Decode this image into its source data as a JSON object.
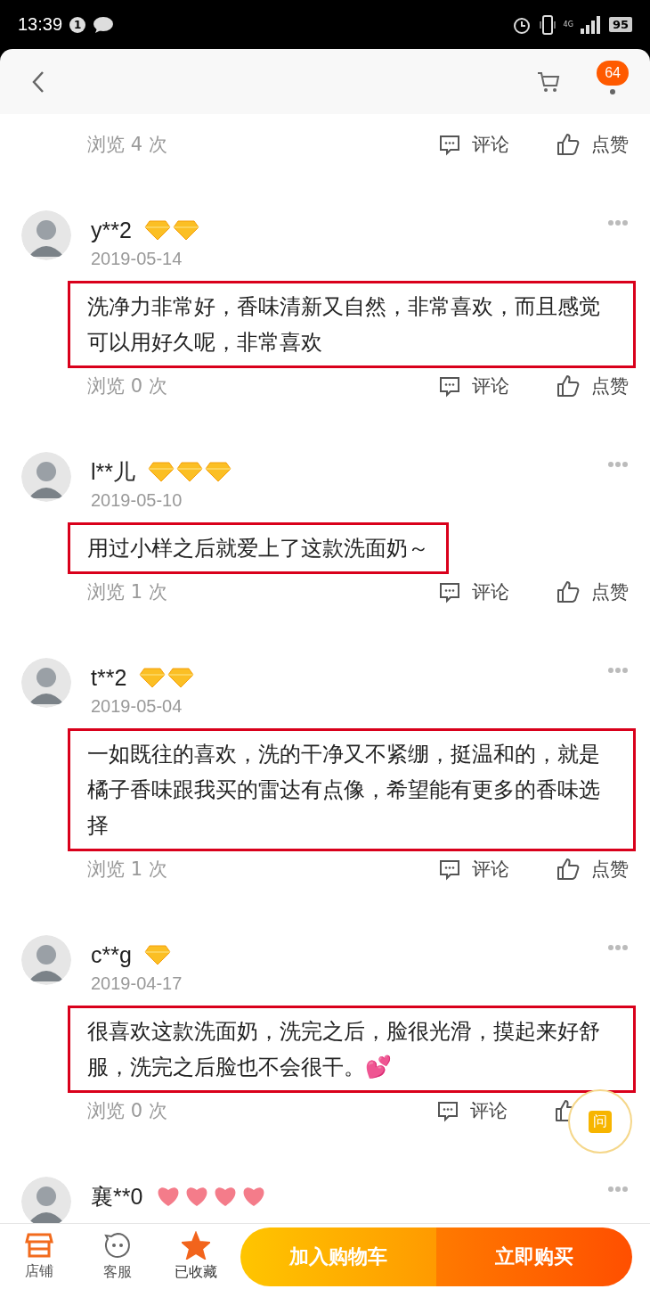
{
  "status_bar": {
    "time": "13:39",
    "notification_count": "1",
    "network": "4G",
    "battery": "95"
  },
  "header": {
    "badge": "64"
  },
  "top_review": {
    "views": "浏览 4 次",
    "comment_label": "评论",
    "like_label": "点赞"
  },
  "reviews": [
    {
      "user": "y**2",
      "badges": [
        {
          "kind": "gem"
        },
        {
          "kind": "gem"
        }
      ],
      "date": "2019-05-14",
      "text": "洗净力非常好，香味清新又自然，非常喜欢，而且感觉可以用好久呢，非常喜欢",
      "highlighted": true,
      "views": "浏览 0 次",
      "comment_label": "评论",
      "like_label": "点赞"
    },
    {
      "user": "l**儿",
      "badges": [
        {
          "kind": "gem"
        },
        {
          "kind": "gem"
        },
        {
          "kind": "gem"
        }
      ],
      "date": "2019-05-10",
      "text": "用过小样之后就爱上了这款洗面奶～",
      "highlighted": true,
      "views": "浏览 1 次",
      "comment_label": "评论",
      "like_label": "点赞"
    },
    {
      "user": "t**2",
      "badges": [
        {
          "kind": "gem"
        },
        {
          "kind": "gem"
        }
      ],
      "date": "2019-05-04",
      "text": "一如既往的喜欢，洗的干净又不紧绷，挺温和的，就是橘子香味跟我买的雷达有点像，希望能有更多的香味选择",
      "highlighted": true,
      "views": "浏览 1 次",
      "comment_label": "评论",
      "like_label": "点赞"
    },
    {
      "user": "c**g",
      "badges": [
        {
          "kind": "gem"
        }
      ],
      "date": "2019-04-17",
      "text": "很喜欢这款洗面奶，洗完之后，脸很光滑，摸起来好舒服，洗完之后脸也不会很干。💕",
      "highlighted": true,
      "views": "浏览 0 次",
      "comment_label": "评论"
    },
    {
      "user": "襄**0",
      "badges": [
        {
          "kind": "heart"
        },
        {
          "kind": "heart"
        },
        {
          "kind": "heart"
        },
        {
          "kind": "heart"
        }
      ]
    }
  ],
  "ask_button": {
    "label": "问"
  },
  "bottom_bar": {
    "items": [
      {
        "kind": "shop",
        "label": "店铺",
        "selected": false
      },
      {
        "kind": "service",
        "label": "客服",
        "selected": false
      },
      {
        "kind": "favorite",
        "label": "已收藏",
        "selected": true
      }
    ],
    "add_to_cart": "加入购物车",
    "buy_now": "立即购买"
  }
}
